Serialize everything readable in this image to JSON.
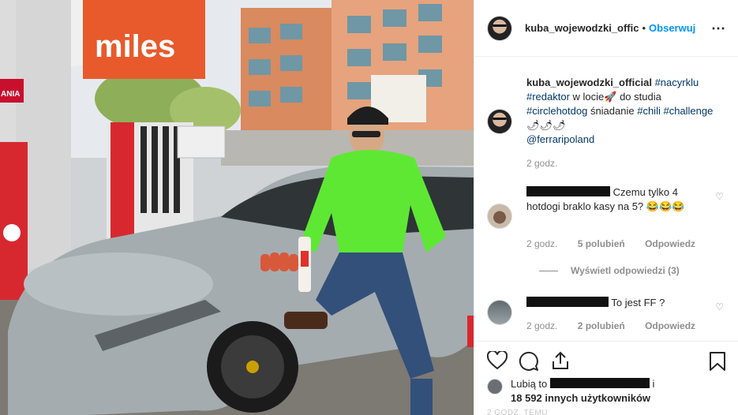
{
  "photo": {
    "sign_text": "miles",
    "station_panel_text": "ANIA",
    "description_alt": "Post photo"
  },
  "header": {
    "username": "kuba_wojewodzki_offic",
    "separator": "•",
    "follow_label": "Obserwuj",
    "more_icon": "⋯"
  },
  "caption": {
    "username": "kuba_wojewodzki_official",
    "segments": [
      {
        "text": "#nacyrklu",
        "tag": true
      },
      {
        "text": "#redaktor",
        "tag": true
      },
      {
        "text": " w locie🚀 do studia ",
        "tag": false
      },
      {
        "text": "#circlehotdog",
        "tag": true
      },
      {
        "text": " śniadanie ",
        "tag": false
      },
      {
        "text": "#chili",
        "tag": true
      },
      {
        "text": "#challenge",
        "tag": true
      },
      {
        "text": " 🌶🌶🌶",
        "tag": false
      },
      {
        "text": "@ferraripoland",
        "tag": true
      }
    ],
    "time": "2 godz."
  },
  "comments": [
    {
      "text": "Czemu tylko 4 hotdogi braklo kasy na 5? 😂😂😂",
      "time": "2 godz.",
      "likes": "5 polubień",
      "reply": "Odpowiedz",
      "view_replies": "Wyświetl odpowiedzi (3)"
    },
    {
      "text": "To jest FF ?",
      "time": "2 godz.",
      "likes": "2 polubień",
      "reply": "Odpowiedz"
    }
  ],
  "likes": {
    "prefix": "Lubią to",
    "suffix": "i",
    "count": "18 592 innych użytkowników"
  },
  "truncated_footer": "2 GODZ. TEMU",
  "icons": {
    "like": "heart-icon",
    "comment": "comment-icon",
    "share": "share-icon",
    "save": "bookmark-icon"
  },
  "colors": {
    "accent": "#0095f6",
    "tag": "#00376b",
    "muted": "#8e8e8e",
    "jacket": "#5ee834",
    "car": "#9aa3a8"
  }
}
